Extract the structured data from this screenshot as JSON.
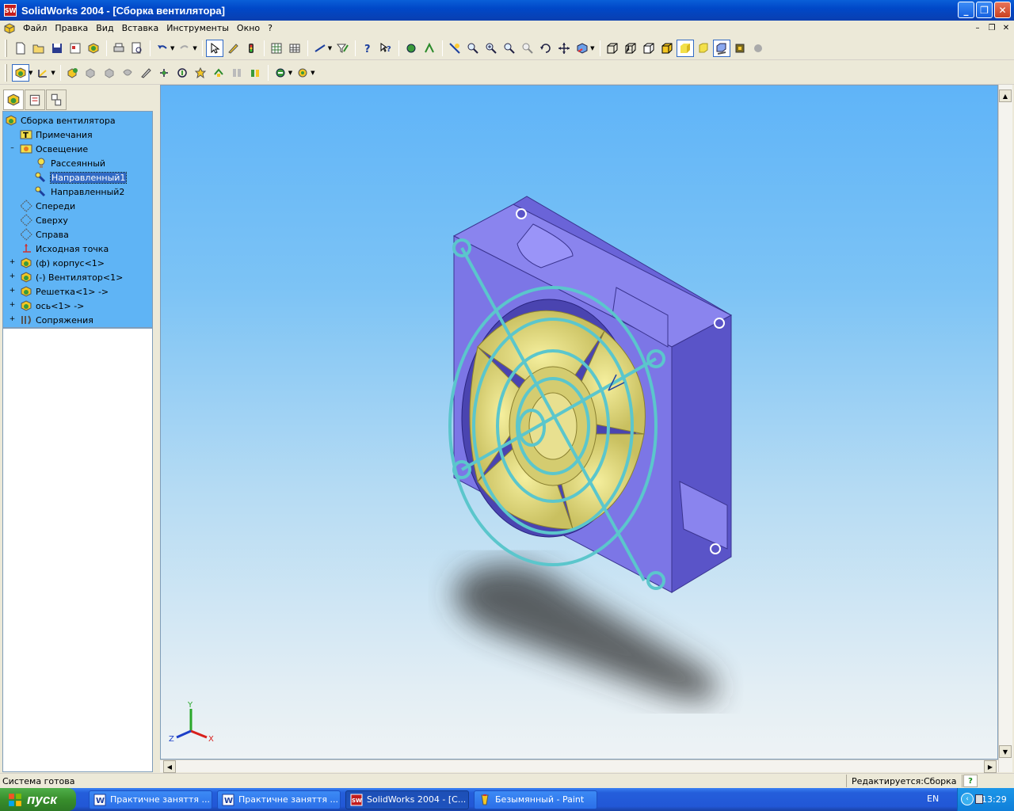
{
  "window": {
    "app_icon_text": "SW",
    "title": "SolidWorks 2004 - [Сборка вентилятора]",
    "controls": {
      "minimize": "_",
      "maximize": "❐",
      "close": "✕"
    }
  },
  "menu": [
    "Файл",
    "Правка",
    "Вид",
    "Вставка",
    "Инструменты",
    "Окно",
    "?"
  ],
  "toolbar1_icons": [
    "new-icon",
    "open-icon",
    "save-icon",
    "make-drawing-icon",
    "make-assembly-icon",
    "print-icon",
    "print-preview-icon",
    "undo-icon",
    "redo-icon",
    "select-icon",
    "sketch-icon",
    "rebuild-icon",
    "options-icon",
    "grid-icon",
    "smart-dimension-icon",
    "filter-icon",
    "help-icon",
    "whats-this-icon",
    "component-icon",
    "mate-icon",
    "zoom-fit-icon",
    "zoom-area-icon",
    "zoom-in-icon",
    "zoom-out-icon",
    "rotate-icon",
    "pan-icon",
    "view-orientation-icon",
    "wireframe-icon",
    "hidden-lines-visible-icon",
    "hidden-lines-removed-icon",
    "shaded-edges-icon",
    "shaded-icon",
    "perspective-icon",
    "shadow-icon",
    "rendering-icon"
  ],
  "toolbar2_icons": [
    "assembly-view-icon",
    "sketch-mode-icon",
    "insert-component-icon",
    "hide-component-icon",
    "show-component-icon",
    "change-transparency-icon",
    "edit-component-icon",
    "move-component-icon",
    "rotate-component-icon",
    "smart-fasteners-icon",
    "mate-toolbar-icon",
    "explode-icon",
    "collision-icon",
    "interference-icon",
    "simulation-icon"
  ],
  "panel_tabs": [
    "feature-manager-tab",
    "property-manager-tab",
    "configuration-manager-tab"
  ],
  "tree": {
    "root": "Сборка вентилятора",
    "items": [
      {
        "label": "Примечания",
        "icon": "annotations-icon",
        "expander": ""
      },
      {
        "label": "Освещение",
        "icon": "lighting-icon",
        "expander": "–"
      },
      {
        "label": "Рассеянный",
        "icon": "ambient-light-icon",
        "expander": ""
      },
      {
        "label": "Направленный1",
        "icon": "directional-light-icon",
        "expander": ""
      },
      {
        "label": "Направленный2",
        "icon": "directional-light-icon",
        "expander": ""
      },
      {
        "label": "Спереди",
        "icon": "plane-icon",
        "expander": ""
      },
      {
        "label": "Сверху",
        "icon": "plane-icon",
        "expander": ""
      },
      {
        "label": "Справа",
        "icon": "plane-icon",
        "expander": ""
      },
      {
        "label": "Исходная точка",
        "icon": "origin-icon",
        "expander": ""
      },
      {
        "label": "(ф) корпус<1>",
        "icon": "part-icon",
        "expander": "+"
      },
      {
        "label": "(-) Вентилятор<1>",
        "icon": "part-icon",
        "expander": "+"
      },
      {
        "label": "Решетка<1> ->",
        "icon": "part-icon",
        "expander": "+"
      },
      {
        "label": "ось<1> ->",
        "icon": "part-icon",
        "expander": "+"
      },
      {
        "label": "Сопряжения",
        "icon": "mates-icon",
        "expander": "+"
      }
    ],
    "selected_index": 3
  },
  "triad": {
    "x": "X",
    "y": "Y",
    "z": "Z"
  },
  "status": {
    "left": "Система готова",
    "right": "Редактируется:Сборка",
    "help": "?"
  },
  "taskbar": {
    "start": "пуск",
    "tasks": [
      {
        "label": "Практичне заняття ...",
        "icon": "word-icon"
      },
      {
        "label": "Практичне заняття ...",
        "icon": "word-icon"
      },
      {
        "label": "SolidWorks 2004 - [С...",
        "icon": "solidworks-icon"
      },
      {
        "label": "Безымянный - Paint",
        "icon": "paint-icon"
      }
    ],
    "active_task": 2,
    "language": "EN",
    "clock": "13:29"
  }
}
